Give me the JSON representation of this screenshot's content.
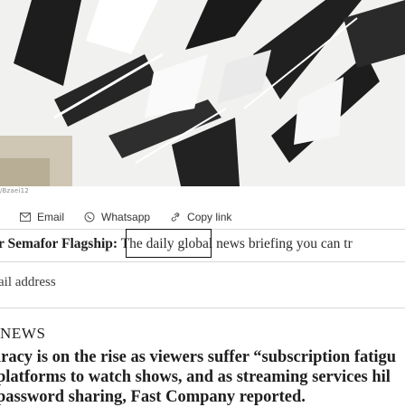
{
  "hero": {
    "credit": "/Bzaei12"
  },
  "share": {
    "email_label": "Email",
    "whatsapp_label": "Whatsapp",
    "copy_label": "Copy link"
  },
  "signup": {
    "lead": "r Semafor Flagship:",
    "body": " The daily global news briefing you can tr",
    "email_placeholder": "ail address"
  },
  "news": {
    "heading": "NEWS",
    "lines": [
      "iracy is on the rise as viewers suffer “subscription fatigu",
      "platforms to watch shows, and as streaming services hil",
      "password sharing, Fast Company reported."
    ]
  },
  "colors": {
    "accent": "#1e1e1e",
    "divider": "#d9d9d9"
  }
}
